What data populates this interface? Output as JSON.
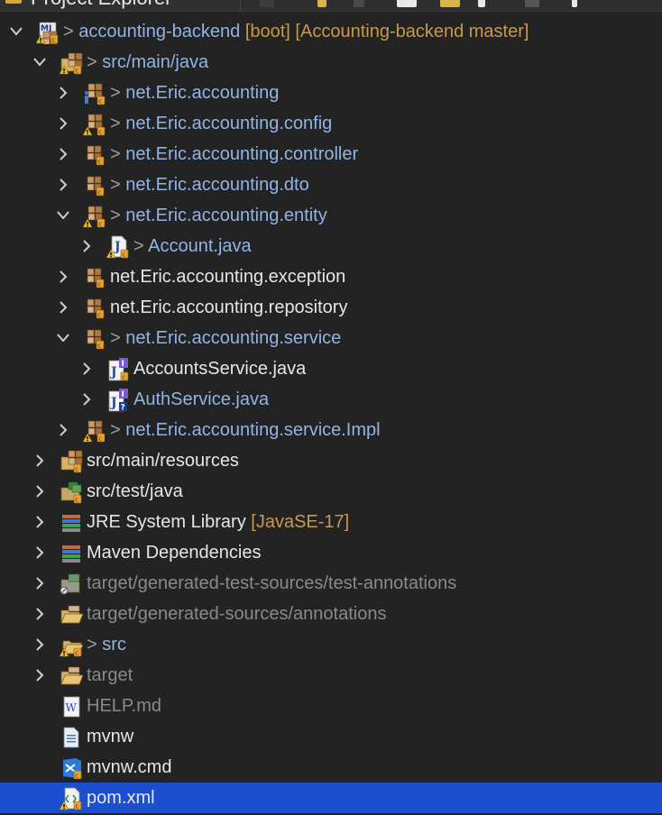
{
  "view_tab": {
    "title": "Project Explorer"
  },
  "tree": [
    {
      "id": "root",
      "depth": 0,
      "chevron": "down",
      "icon": "maven-project",
      "dirty": true,
      "label": "accounting-backend",
      "decorations": [
        "[boot]",
        "[Accounting-backend master]"
      ],
      "style": "blue"
    },
    {
      "id": "src-main-java",
      "depth": 1,
      "chevron": "down",
      "icon": "source-folder",
      "dirty": true,
      "label": "src/main/java",
      "style": "blue"
    },
    {
      "id": "pkg-accounting",
      "depth": 2,
      "chevron": "right",
      "icon": "package-info",
      "dirty": true,
      "label": "net.Eric.accounting",
      "style": "blue"
    },
    {
      "id": "pkg-config",
      "depth": 2,
      "chevron": "right",
      "icon": "package-warn",
      "dirty": true,
      "label": "net.Eric.accounting.config",
      "style": "blue"
    },
    {
      "id": "pkg-controller",
      "depth": 2,
      "chevron": "right",
      "icon": "package",
      "dirty": true,
      "label": "net.Eric.accounting.controller",
      "style": "blue"
    },
    {
      "id": "pkg-dto",
      "depth": 2,
      "chevron": "right",
      "icon": "package",
      "dirty": true,
      "label": "net.Eric.accounting.dto",
      "style": "blue"
    },
    {
      "id": "pkg-entity",
      "depth": 2,
      "chevron": "down",
      "icon": "package-warn",
      "dirty": true,
      "label": "net.Eric.accounting.entity",
      "style": "blue"
    },
    {
      "id": "file-account",
      "depth": 3,
      "chevron": "right",
      "icon": "java-file-warn",
      "dirty": true,
      "label": "Account.java",
      "style": "blue"
    },
    {
      "id": "pkg-exception",
      "depth": 2,
      "chevron": "right",
      "icon": "package",
      "dirty": false,
      "label": "net.Eric.accounting.exception",
      "style": "white"
    },
    {
      "id": "pkg-repository",
      "depth": 2,
      "chevron": "right",
      "icon": "package",
      "dirty": false,
      "label": "net.Eric.accounting.repository",
      "style": "white"
    },
    {
      "id": "pkg-service",
      "depth": 2,
      "chevron": "down",
      "icon": "package",
      "dirty": true,
      "label": "net.Eric.accounting.service",
      "style": "blue"
    },
    {
      "id": "file-accountsservice",
      "depth": 3,
      "chevron": "right",
      "icon": "java-interface",
      "dirty": false,
      "label": "AccountsService.java",
      "style": "white"
    },
    {
      "id": "file-authservice",
      "depth": 3,
      "chevron": "right",
      "icon": "java-interface-unknown",
      "dirty": false,
      "label": "AuthService.java",
      "style": "blue"
    },
    {
      "id": "pkg-service-impl",
      "depth": 2,
      "chevron": "right",
      "icon": "package-warn",
      "dirty": true,
      "label": "net.Eric.accounting.service.Impl",
      "style": "blue"
    },
    {
      "id": "src-main-resources",
      "depth": 1,
      "chevron": "right",
      "icon": "resource-folder",
      "dirty": false,
      "label": "src/main/resources",
      "style": "white"
    },
    {
      "id": "src-test-java",
      "depth": 1,
      "chevron": "right",
      "icon": "source-folder-plain",
      "dirty": false,
      "label": "src/test/java",
      "style": "white"
    },
    {
      "id": "jre-library",
      "depth": 1,
      "chevron": "right",
      "icon": "library",
      "dirty": false,
      "label": "JRE System Library",
      "decorations": [
        "[JavaSE-17]"
      ],
      "style": "white"
    },
    {
      "id": "maven-deps",
      "depth": 1,
      "chevron": "right",
      "icon": "library",
      "dirty": false,
      "label": "Maven Dependencies",
      "style": "white"
    },
    {
      "id": "target-gen-test",
      "depth": 1,
      "chevron": "right",
      "icon": "source-folder-ignored",
      "dirty": false,
      "label": "target/generated-test-sources/test-annotations",
      "style": "grey"
    },
    {
      "id": "target-gen-src",
      "depth": 1,
      "chevron": "right",
      "icon": "folder-open",
      "dirty": false,
      "label": "target/generated-sources/annotations",
      "style": "grey"
    },
    {
      "id": "src",
      "depth": 1,
      "chevron": "right",
      "icon": "folder-warn",
      "dirty": true,
      "label": "src",
      "style": "blue"
    },
    {
      "id": "target",
      "depth": 1,
      "chevron": "right",
      "icon": "folder-open",
      "dirty": false,
      "label": "target",
      "style": "grey"
    },
    {
      "id": "help-md",
      "depth": 1,
      "chevron": "none",
      "icon": "doc-w",
      "dirty": false,
      "label": "HELP.md",
      "style": "grey"
    },
    {
      "id": "mvnw",
      "depth": 1,
      "chevron": "none",
      "icon": "text-file",
      "dirty": false,
      "label": "mvnw",
      "style": "white"
    },
    {
      "id": "mvnw-cmd",
      "depth": 1,
      "chevron": "none",
      "icon": "vscode-file",
      "dirty": false,
      "label": "mvnw.cmd",
      "style": "white"
    },
    {
      "id": "pom-xml",
      "depth": 1,
      "chevron": "none",
      "icon": "xml-file-warn",
      "dirty": false,
      "label": "pom.xml",
      "style": "white",
      "selected": true
    }
  ],
  "colors": {
    "background": "#232323",
    "selection": "#1b4fd0",
    "dirty_text": "#91b4e4",
    "decoration_text": "#c79a4a",
    "ignored_text": "#8a8a8a"
  }
}
